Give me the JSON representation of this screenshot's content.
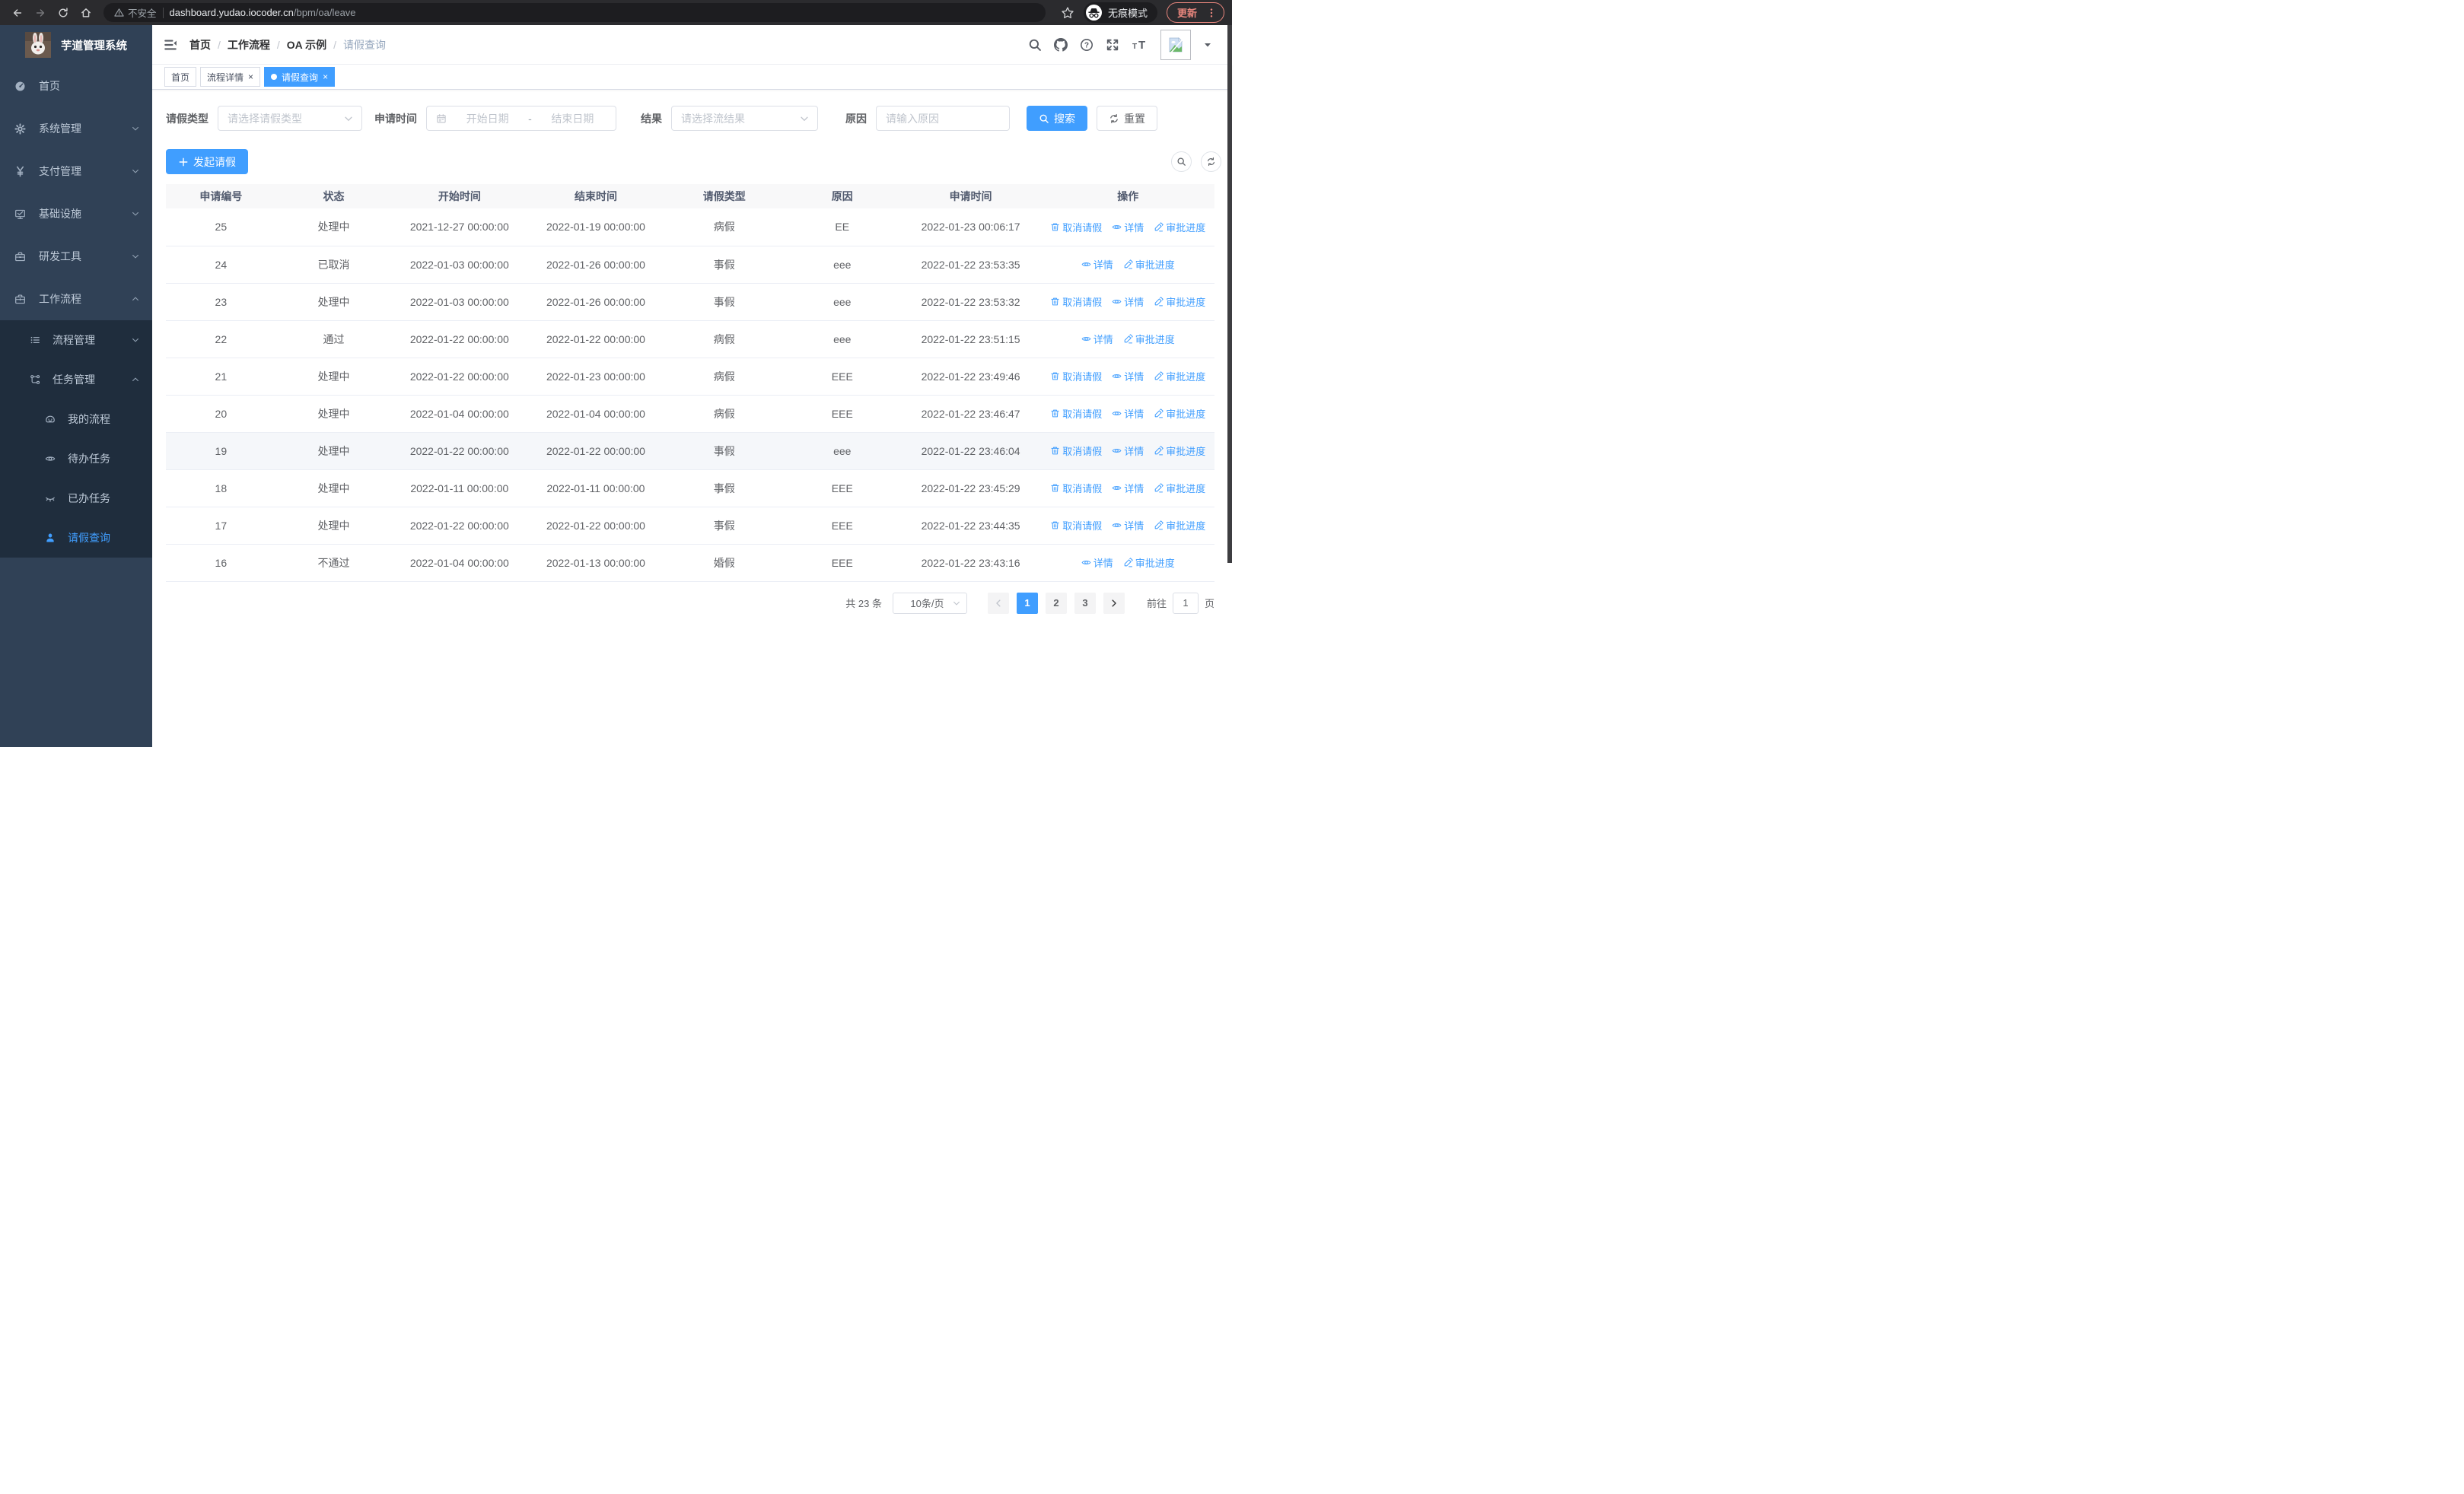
{
  "browser": {
    "security_label": "不安全",
    "url_host": "dashboard.yudao.iocoder.cn",
    "url_path": "/bpm/oa/leave",
    "incognito_label": "无痕模式",
    "update_label": "更新"
  },
  "sidebar": {
    "logo_title": "芋道管理系统",
    "menu": [
      {
        "name": "home",
        "label": "首页",
        "icon": "gauge-icon",
        "arrow": null
      },
      {
        "name": "system",
        "label": "系统管理",
        "icon": "gear-icon",
        "arrow": "down"
      },
      {
        "name": "payment",
        "label": "支付管理",
        "icon": "yen-icon",
        "arrow": "down"
      },
      {
        "name": "infra",
        "label": "基础设施",
        "icon": "monitor-icon",
        "arrow": "down"
      },
      {
        "name": "devtools",
        "label": "研发工具",
        "icon": "toolbox-icon",
        "arrow": "down"
      },
      {
        "name": "workflow",
        "label": "工作流程",
        "icon": "briefcase-icon",
        "arrow": "up"
      }
    ],
    "submenu": [
      {
        "name": "process-mgmt",
        "label": "流程管理",
        "icon": "list-icon",
        "arrow": "down",
        "level": 1
      },
      {
        "name": "task-mgmt",
        "label": "任务管理",
        "icon": "flow-icon",
        "arrow": "up",
        "level": 1
      },
      {
        "name": "my-process",
        "label": "我的流程",
        "icon": "face-icon",
        "arrow": null,
        "level": 2
      },
      {
        "name": "todo-tasks",
        "label": "待办任务",
        "icon": "eye-icon",
        "arrow": null,
        "level": 2
      },
      {
        "name": "done-tasks",
        "label": "已办任务",
        "icon": "eye-closed-icon",
        "arrow": null,
        "level": 2
      },
      {
        "name": "leave-query",
        "label": "请假查询",
        "icon": "user-icon",
        "arrow": null,
        "level": 2,
        "active": true
      }
    ]
  },
  "header": {
    "breadcrumb": [
      "首页",
      "工作流程",
      "OA 示例",
      "请假查询"
    ]
  },
  "tabs": [
    {
      "name": "home",
      "label": "首页",
      "closable": false,
      "active": false
    },
    {
      "name": "process-detail",
      "label": "流程详情",
      "closable": true,
      "active": false
    },
    {
      "name": "leave-query",
      "label": "请假查询",
      "closable": true,
      "active": true
    }
  ],
  "filters": {
    "type_label": "请假类型",
    "type_placeholder": "请选择请假类型",
    "time_label": "申请时间",
    "start_placeholder": "开始日期",
    "range_separator": "-",
    "end_placeholder": "结束日期",
    "result_label": "结果",
    "result_placeholder": "请选择流结果",
    "reason_label": "原因",
    "reason_placeholder": "请输入原因",
    "search_label": "搜索",
    "reset_label": "重置"
  },
  "toolbar": {
    "create_label": "发起请假"
  },
  "table": {
    "columns": [
      "申请编号",
      "状态",
      "开始时间",
      "结束时间",
      "请假类型",
      "原因",
      "申请时间",
      "操作"
    ],
    "actions": {
      "cancel": "取消请假",
      "detail": "详情",
      "progress": "审批进度"
    },
    "rows": [
      {
        "id": "25",
        "status": "处理中",
        "start": "2021-12-27 00:00:00",
        "end": "2022-01-19 00:00:00",
        "type": "病假",
        "reason": "EE",
        "applied": "2022-01-23 00:06:17",
        "cancellable": true,
        "highlight": false
      },
      {
        "id": "24",
        "status": "已取消",
        "start": "2022-01-03 00:00:00",
        "end": "2022-01-26 00:00:00",
        "type": "事假",
        "reason": "eee",
        "applied": "2022-01-22 23:53:35",
        "cancellable": false,
        "highlight": false
      },
      {
        "id": "23",
        "status": "处理中",
        "start": "2022-01-03 00:00:00",
        "end": "2022-01-26 00:00:00",
        "type": "事假",
        "reason": "eee",
        "applied": "2022-01-22 23:53:32",
        "cancellable": true,
        "highlight": false
      },
      {
        "id": "22",
        "status": "通过",
        "start": "2022-01-22 00:00:00",
        "end": "2022-01-22 00:00:00",
        "type": "病假",
        "reason": "eee",
        "applied": "2022-01-22 23:51:15",
        "cancellable": false,
        "highlight": false
      },
      {
        "id": "21",
        "status": "处理中",
        "start": "2022-01-22 00:00:00",
        "end": "2022-01-23 00:00:00",
        "type": "病假",
        "reason": "EEE",
        "applied": "2022-01-22 23:49:46",
        "cancellable": true,
        "highlight": false
      },
      {
        "id": "20",
        "status": "处理中",
        "start": "2022-01-04 00:00:00",
        "end": "2022-01-04 00:00:00",
        "type": "病假",
        "reason": "EEE",
        "applied": "2022-01-22 23:46:47",
        "cancellable": true,
        "highlight": false
      },
      {
        "id": "19",
        "status": "处理中",
        "start": "2022-01-22 00:00:00",
        "end": "2022-01-22 00:00:00",
        "type": "事假",
        "reason": "eee",
        "applied": "2022-01-22 23:46:04",
        "cancellable": true,
        "highlight": true
      },
      {
        "id": "18",
        "status": "处理中",
        "start": "2022-01-11 00:00:00",
        "end": "2022-01-11 00:00:00",
        "type": "事假",
        "reason": "EEE",
        "applied": "2022-01-22 23:45:29",
        "cancellable": true,
        "highlight": false
      },
      {
        "id": "17",
        "status": "处理中",
        "start": "2022-01-22 00:00:00",
        "end": "2022-01-22 00:00:00",
        "type": "事假",
        "reason": "EEE",
        "applied": "2022-01-22 23:44:35",
        "cancellable": true,
        "highlight": false
      },
      {
        "id": "16",
        "status": "不通过",
        "start": "2022-01-04 00:00:00",
        "end": "2022-01-13 00:00:00",
        "type": "婚假",
        "reason": "EEE",
        "applied": "2022-01-22 23:43:16",
        "cancellable": false,
        "highlight": false
      }
    ]
  },
  "pagination": {
    "total": "共 23 条",
    "size": "10条/页",
    "pages": [
      "1",
      "2",
      "3"
    ],
    "active_page": "1",
    "goto_label": "前往",
    "goto_value": "1",
    "unit": "页"
  },
  "colors": {
    "accent": "#409eff",
    "sidebar_bg": "#304156",
    "submenu_bg": "#1f2d3d",
    "table_header_bg": "#f8f8f9",
    "update_accent": "#e8867d",
    "row_highlight": "#f5f7fa"
  }
}
